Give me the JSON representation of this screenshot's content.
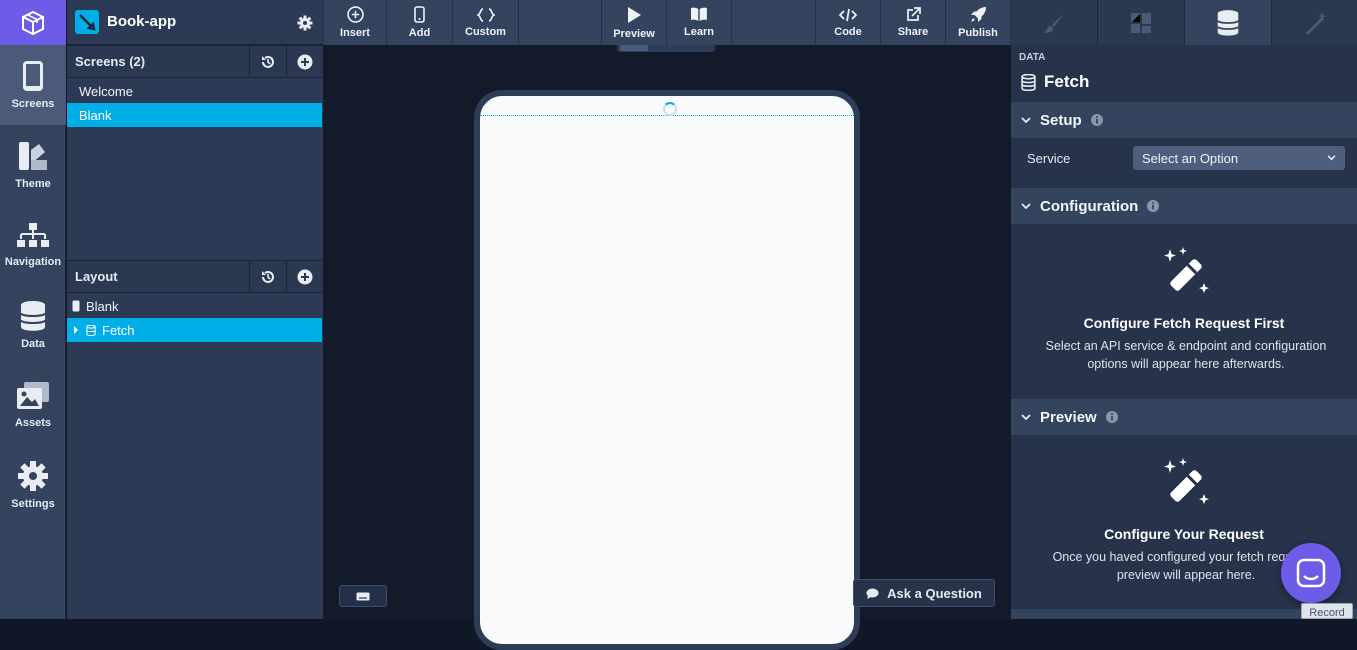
{
  "app": {
    "name": "Book-app"
  },
  "rail": {
    "items": [
      {
        "label": "Screens",
        "icon": "phone-icon"
      },
      {
        "label": "Theme",
        "icon": "theme-icon"
      },
      {
        "label": "Navigation",
        "icon": "sitemap-icon"
      },
      {
        "label": "Data",
        "icon": "database-icon"
      },
      {
        "label": "Assets",
        "icon": "images-icon"
      },
      {
        "label": "Settings",
        "icon": "gear-icon"
      }
    ]
  },
  "screens": {
    "title": "Screens (2)",
    "items": [
      "Welcome",
      "Blank"
    ],
    "selected": "Blank"
  },
  "layout": {
    "title": "Layout",
    "items": [
      "Blank",
      "Fetch"
    ],
    "selected": "Fetch"
  },
  "toolbar": {
    "insert": "Insert",
    "add": "Add",
    "custom": "Custom",
    "preview": "Preview",
    "learn": "Learn",
    "code": "Code",
    "share": "Share",
    "publish": "Publish"
  },
  "right": {
    "eyebrow": "DATA",
    "title": "Fetch",
    "setup": {
      "title": "Setup",
      "service_label": "Service",
      "service_value": "Select an Option"
    },
    "configuration": {
      "title": "Configuration",
      "heading": "Configure Fetch Request First",
      "body": "Select an API service & endpoint and configuration options will appear here afterwards."
    },
    "preview": {
      "title": "Preview",
      "heading": "Configure Your Request",
      "body": "Once you haved configured your fetch request a preview will appear here."
    }
  },
  "help": {
    "ask": "Ask a Question",
    "record": "Record"
  },
  "colors": {
    "accent": "#6c5ce7",
    "selection": "#00aee8"
  }
}
